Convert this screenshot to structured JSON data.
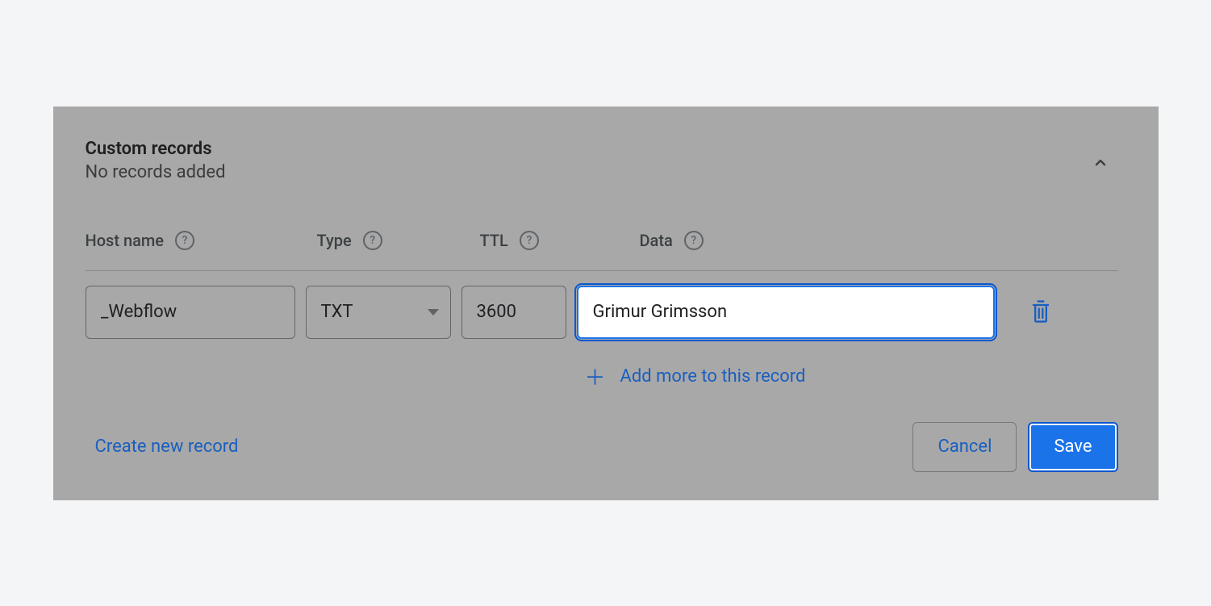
{
  "header": {
    "title": "Custom records",
    "subtitle": "No records added"
  },
  "columns": {
    "hostname": "Host name",
    "type": "Type",
    "ttl": "TTL",
    "data": "Data"
  },
  "record": {
    "hostname": "_Webflow",
    "type": "TXT",
    "ttl": "3600",
    "data": "Grimur Grimsson"
  },
  "actions": {
    "add_more": "Add more to this record",
    "create_new": "Create new record",
    "cancel": "Cancel",
    "save": "Save"
  }
}
